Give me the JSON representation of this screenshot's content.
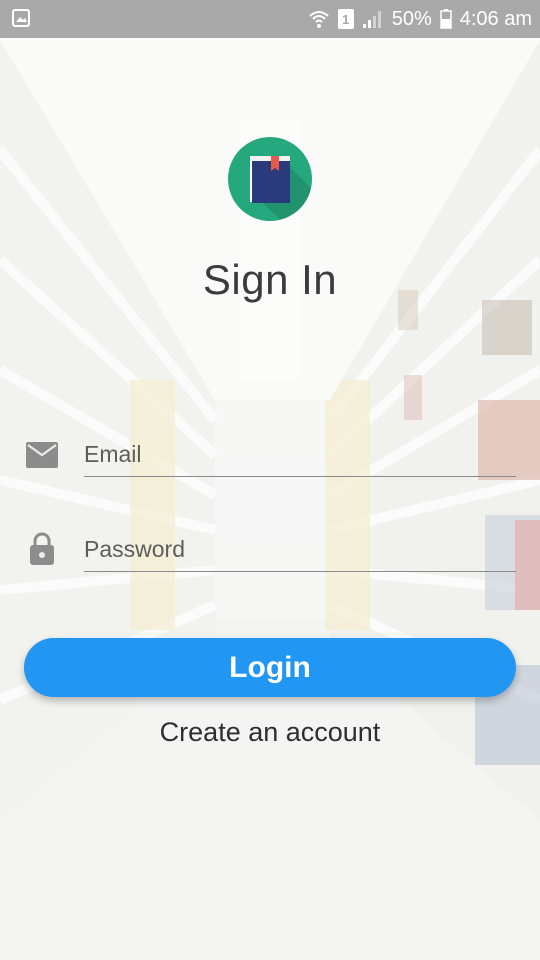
{
  "status_bar": {
    "sim_label": "1",
    "battery": "50%",
    "time": "4:06 am"
  },
  "app": {
    "title": "Sign In",
    "logo_icon": "book-icon",
    "accent_color": "#2196f3",
    "logo_bg_color": "#26a87f"
  },
  "form": {
    "email_placeholder": "Email",
    "email_value": "",
    "password_placeholder": "Password",
    "password_value": "",
    "email_icon": "mail-icon",
    "password_icon": "lock-icon"
  },
  "actions": {
    "login_label": "Login",
    "create_account_label": "Create an account"
  }
}
